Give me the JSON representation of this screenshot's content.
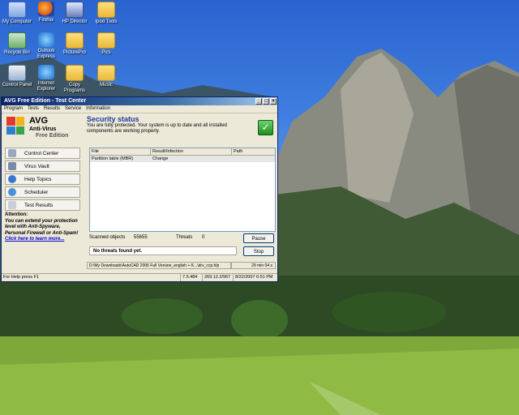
{
  "desktop": {
    "icons": [
      {
        "label": "My Computer",
        "icon": "my-computer-icon"
      },
      {
        "label": "Firefox",
        "icon": "firefox-icon"
      },
      {
        "label": "HP Director",
        "icon": "hp-director-icon"
      },
      {
        "label": "Ipod Tools",
        "icon": "folder-icon"
      },
      {
        "label": "Recycle Bin",
        "icon": "recycle-bin-icon"
      },
      {
        "label": "Outlook Express",
        "icon": "outlook-express-icon"
      },
      {
        "label": "PicturePro",
        "icon": "folder-icon"
      },
      {
        "label": "Pics",
        "icon": "folder-icon"
      },
      {
        "label": "Control Panel",
        "icon": "control-panel-icon"
      },
      {
        "label": "Internet Explorer",
        "icon": "internet-explorer-icon"
      },
      {
        "label": "Copy Programs",
        "icon": "folder-icon"
      },
      {
        "label": "Music",
        "icon": "folder-icon"
      }
    ]
  },
  "window": {
    "title": "AVG Free Edition - Test Center",
    "controls": {
      "minimize": "_",
      "maximize": "□",
      "close": "×"
    },
    "menu": [
      "Program",
      "Tests",
      "Results",
      "Service",
      "Information"
    ],
    "brand": {
      "name": "AVG",
      "product": "Anti-Virus",
      "edition": "Free Edition"
    },
    "nav": [
      {
        "label": "Control Center",
        "icon": "control-center-icon"
      },
      {
        "label": "Virus Vault",
        "icon": "virus-vault-icon"
      },
      {
        "label": "Help Topics",
        "icon": "help-icon"
      },
      {
        "label": "Scheduler",
        "icon": "scheduler-icon"
      },
      {
        "label": "Test Results",
        "icon": "test-results-icon"
      }
    ],
    "attention": {
      "heading": "Attention:",
      "body": "You can extend your protection level with Anti-Spyware, Personal Firewall or Anti-Spam!",
      "link": "Click here to learn more..."
    },
    "security": {
      "title": "Security status",
      "text": "You are fully protected. Your system is up to date and all installed components are working properly."
    },
    "table": {
      "columns": [
        "File",
        "Result/Infection",
        "Path"
      ],
      "rows": [
        {
          "file": "Partition table (MBR)",
          "result": "Change",
          "path": ""
        }
      ]
    },
    "stats": {
      "scanned_label": "Scanned objects",
      "scanned_value": "55655",
      "threats_label": "Threats",
      "threats_value": "0"
    },
    "buttons": {
      "pause": "Pause",
      "stop": "Stop"
    },
    "no_threats": "No threats found yet.",
    "current_path": "D:\\My Downloads\\AutoCAD 2006 Full Version_english + K...\\drv_ccp.hlp",
    "elapsed": "29 min 04 s",
    "status": {
      "help": "For Help press F1",
      "version": "7.5.484",
      "db": "269.12.2/967",
      "date": "8/22/2007 6:51 PM"
    }
  },
  "colors": {
    "title_blue": "#0a246a",
    "accent_blue": "#1c3a9e",
    "ok_green": "#1f8d1f"
  }
}
